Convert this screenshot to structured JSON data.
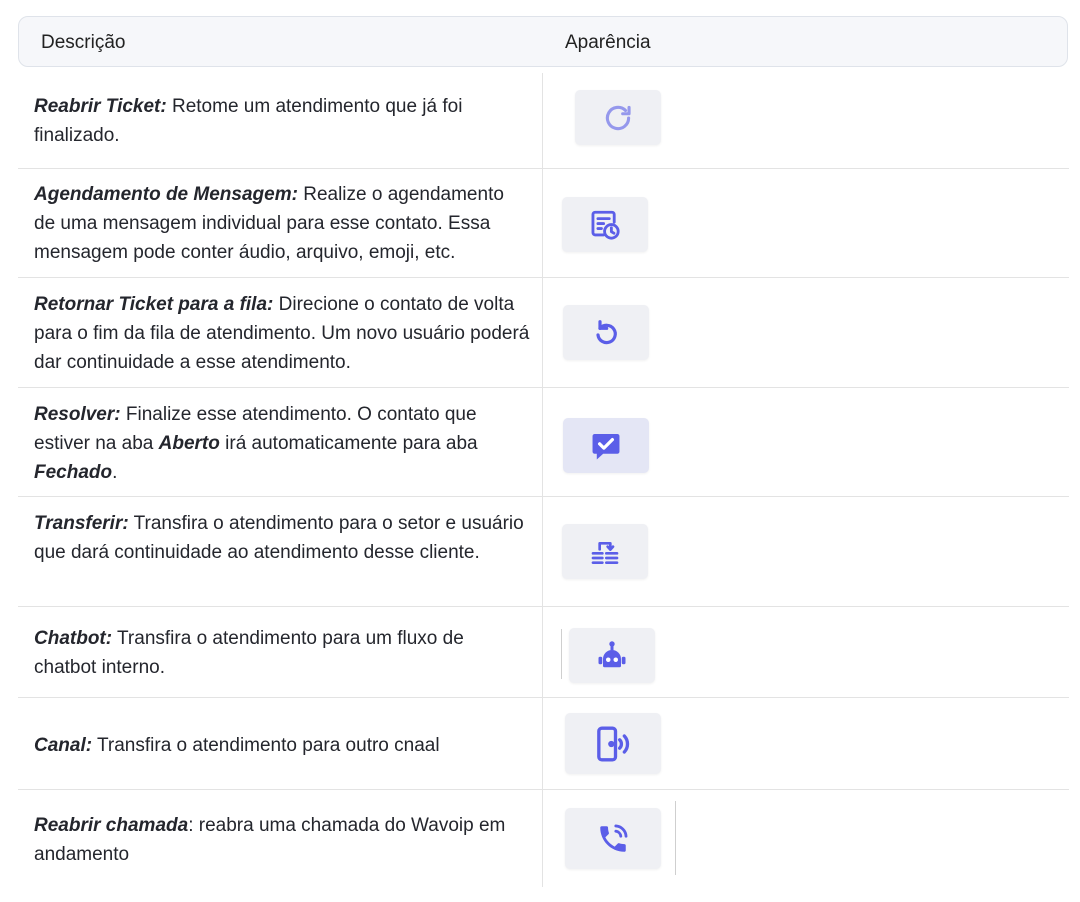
{
  "header": {
    "description": "Descrição",
    "appearance": "Aparência"
  },
  "accent_color": "#5b5ee8",
  "rows": [
    {
      "title": "Reabrir Ticket:",
      "text": " Retome um atendimento que já foi finalizado.",
      "icon": "reopen-ticket-icon"
    },
    {
      "title": "Agendamento de Mensagem:",
      "text": " Realize o agendamento de uma mensagem individual para esse contato. Essa mensagem pode conter áudio, arquivo, emoji, etc.",
      "icon": "schedule-message-icon"
    },
    {
      "title": "Retornar Ticket para a fila:",
      "text": " Direcione o contato de volta para o fim da fila de atendimento. Um novo usuário poderá dar continuidade a esse atendimento.",
      "icon": "return-queue-icon"
    },
    {
      "title": "Resolver:",
      "text_a": " Finalize esse atendimento. O contato que estiver na aba ",
      "bold_a": "Aberto",
      "text_b": " irá automaticamente para aba ",
      "bold_b": "Fechado",
      "text_c": ".",
      "icon": "resolve-icon"
    },
    {
      "title": "Transferir:",
      "text": " Transfira o atendimento para o setor e usuário que dará continuidade ao atendimento desse cliente.",
      "icon": "transfer-icon"
    },
    {
      "title": "Chatbot:",
      "text": " Transfira o atendimento para um fluxo de chatbot interno.",
      "icon": "chatbot-icon"
    },
    {
      "title": "Canal:",
      "text": " Transfira o atendimento para outro cnaal",
      "icon": "channel-icon"
    },
    {
      "title": "Reabrir chamada",
      "text": ": reabra uma chamada do Wavoip em andamento",
      "icon": "reopen-call-icon"
    }
  ]
}
